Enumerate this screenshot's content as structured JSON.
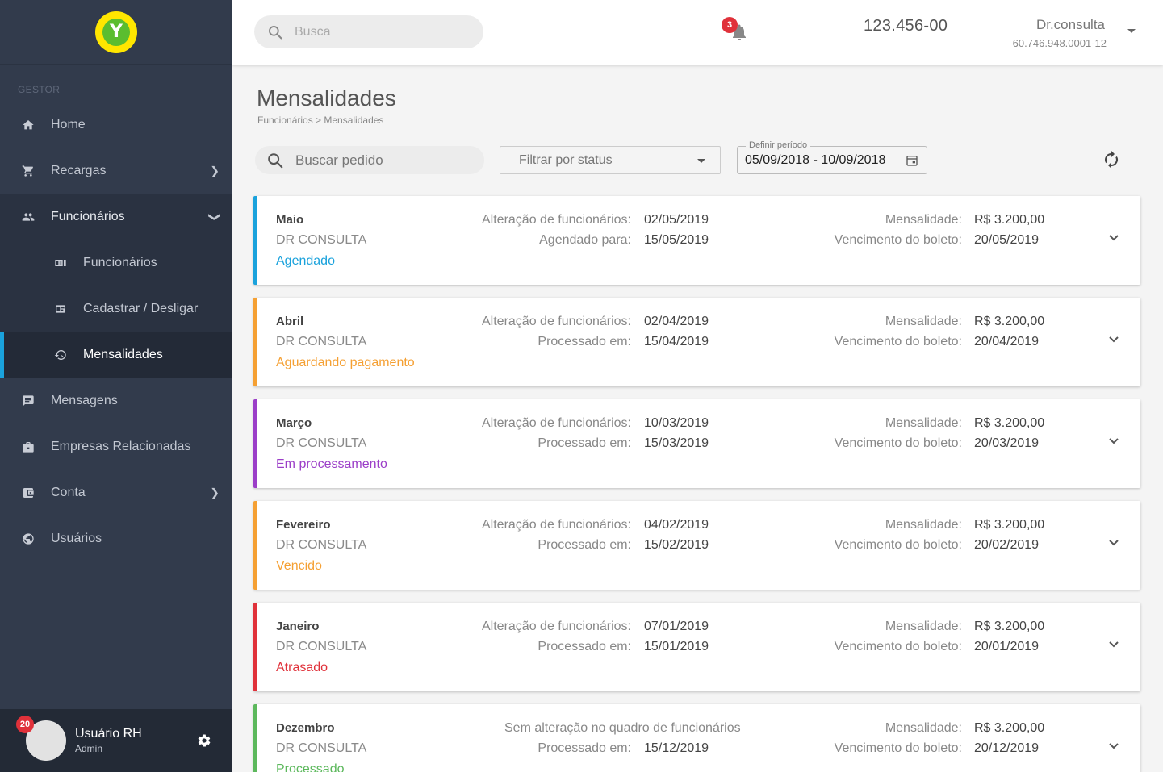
{
  "sidebar": {
    "logo_letter": "Y",
    "section_label": "GESTOR",
    "items": [
      {
        "label": "Home",
        "icon": "home-icon"
      },
      {
        "label": "Recargas",
        "icon": "cart-icon"
      },
      {
        "label": "Funcionários",
        "icon": "people-icon"
      },
      {
        "label": "Funcionários",
        "icon": "badge-icon"
      },
      {
        "label": "Cadastrar / Desligar",
        "icon": "id-card-icon"
      },
      {
        "label": "Mensalidades",
        "icon": "history-icon"
      },
      {
        "label": "Mensagens",
        "icon": "message-icon"
      },
      {
        "label": "Empresas Relacionadas",
        "icon": "briefcase-icon"
      },
      {
        "label": "Conta",
        "icon": "wallet-icon"
      },
      {
        "label": "Usuários",
        "icon": "globe-icon"
      }
    ],
    "user": {
      "name": "Usuário RH",
      "role": "Admin",
      "badge": "20"
    }
  },
  "topbar": {
    "search_placeholder": "Busca",
    "notifications": "3",
    "account_number": "123.456-00",
    "profile_name": "Dr.consulta",
    "profile_id": "60.746.948.0001-12"
  },
  "page": {
    "title": "Mensalidades",
    "breadcrumb": "Funcionários > Mensalidades",
    "search_placeholder": "Buscar pedido",
    "status_filter": "Filtrar por status",
    "period_label": "Definir período",
    "period_value": "05/09/2018 - 10/09/2018"
  },
  "colors": {
    "accent": "#1aa2dc",
    "sidebar": "#323b4c",
    "agendado": "#1aa2dc",
    "aguardando": "#f5a033",
    "processamento": "#9b3ec8",
    "vencido": "#f5a033",
    "atrasado": "#e0313a",
    "processado": "#5cb85c"
  },
  "cards": [
    {
      "month": "Maio",
      "company": "DR CONSULTA",
      "status": "Agendado",
      "color": "#1aa2dc",
      "label1": "Alteração de funcionários:",
      "value1": "02/05/2019",
      "label2": "Agendado para:",
      "value2": "15/05/2019",
      "mlabel": "Mensalidade:",
      "mvalue": "R$ 3.200,00",
      "vlabel": "Vencimento do boleto:",
      "vvalue": "20/05/2019"
    },
    {
      "month": "Abril",
      "company": "DR CONSULTA",
      "status": "Aguardando pagamento",
      "color": "#f5a033",
      "label1": "Alteração de funcionários:",
      "value1": "02/04/2019",
      "label2": "Processado em:",
      "value2": "15/04/2019",
      "mlabel": "Mensalidade:",
      "mvalue": "R$ 3.200,00",
      "vlabel": "Vencimento do boleto:",
      "vvalue": "20/04/2019"
    },
    {
      "month": "Março",
      "company": "DR CONSULTA",
      "status": "Em processamento",
      "color": "#9b3ec8",
      "label1": "Alteração de funcionários:",
      "value1": "10/03/2019",
      "label2": "Processado em:",
      "value2": "15/03/2019",
      "mlabel": "Mensalidade:",
      "mvalue": "R$ 3.200,00",
      "vlabel": "Vencimento do boleto:",
      "vvalue": "20/03/2019"
    },
    {
      "month": "Fevereiro",
      "company": "DR CONSULTA",
      "status": "Vencido",
      "color": "#f5a033",
      "label1": "Alteração de funcionários:",
      "value1": "04/02/2019",
      "label2": "Processado em:",
      "value2": "15/02/2019",
      "mlabel": "Mensalidade:",
      "mvalue": "R$ 3.200,00",
      "vlabel": "Vencimento do boleto:",
      "vvalue": "20/02/2019"
    },
    {
      "month": "Janeiro",
      "company": "DR CONSULTA",
      "status": "Atrasado",
      "color": "#e0313a",
      "label1": "Alteração de funcionários:",
      "value1": "07/01/2019",
      "label2": "Processado em:",
      "value2": "15/01/2019",
      "mlabel": "Mensalidade:",
      "mvalue": "R$ 3.200,00",
      "vlabel": "Vencimento do boleto:",
      "vvalue": "20/01/2019"
    },
    {
      "month": "Dezembro",
      "company": "DR CONSULTA",
      "status": "Processado",
      "color": "#5cb85c",
      "nochange": "Sem alteração no quadro de funcionários",
      "label2": "Processado em:",
      "value2": "15/12/2019",
      "mlabel": "Mensalidade:",
      "mvalue": "R$ 3.200,00",
      "vlabel": "Vencimento do boleto:",
      "vvalue": "20/12/2019"
    }
  ]
}
